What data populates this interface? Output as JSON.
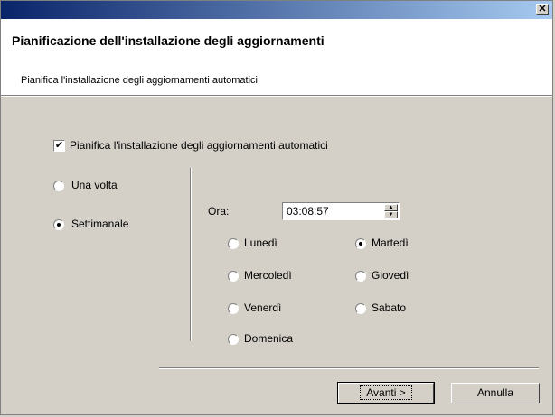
{
  "window": {
    "close_glyph": "✕"
  },
  "header": {
    "title": "Pianificazione dell'installazione degli aggiornamenti",
    "subtitle": "Pianifica l'installazione degli aggiornamenti automatici"
  },
  "schedule": {
    "checkbox_label": "Pianifica l'installazione degli aggiornamenti automatici",
    "checked": true,
    "frequency": {
      "once_label": "Una volta",
      "weekly_label": "Settimanale",
      "selected": "Settimanale"
    },
    "time": {
      "label": "Ora:",
      "value": "03:08:57"
    },
    "days": {
      "monday": "Lunedì",
      "tuesday": "Martedì",
      "wednesday": "Mercoledì",
      "thursday": "Giovedì",
      "friday": "Venerdì",
      "saturday": "Sabato",
      "sunday": "Domenica",
      "selected": "Martedì"
    }
  },
  "footer": {
    "next_label": "Avanti >",
    "cancel_label": "Annulla"
  }
}
